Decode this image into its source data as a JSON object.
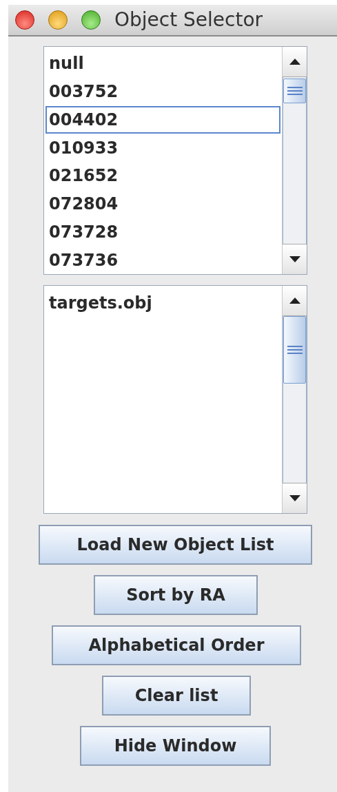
{
  "window": {
    "title": "Object Selector"
  },
  "object_list": {
    "items": [
      {
        "label": "null",
        "selected": false
      },
      {
        "label": "003752",
        "selected": false
      },
      {
        "label": "004402",
        "selected": true
      },
      {
        "label": "010933",
        "selected": false
      },
      {
        "label": "021652",
        "selected": false
      },
      {
        "label": "072804",
        "selected": false
      },
      {
        "label": "073728",
        "selected": false
      },
      {
        "label": "073736",
        "selected": false
      }
    ]
  },
  "file_list": {
    "items": [
      {
        "label": "targets.obj",
        "selected": false
      }
    ]
  },
  "buttons": [
    {
      "label": "Load New Object List"
    },
    {
      "label": "Sort by RA"
    },
    {
      "label": "Alphabetical Order"
    },
    {
      "label": "Clear list"
    },
    {
      "label": "Hide Window"
    }
  ]
}
